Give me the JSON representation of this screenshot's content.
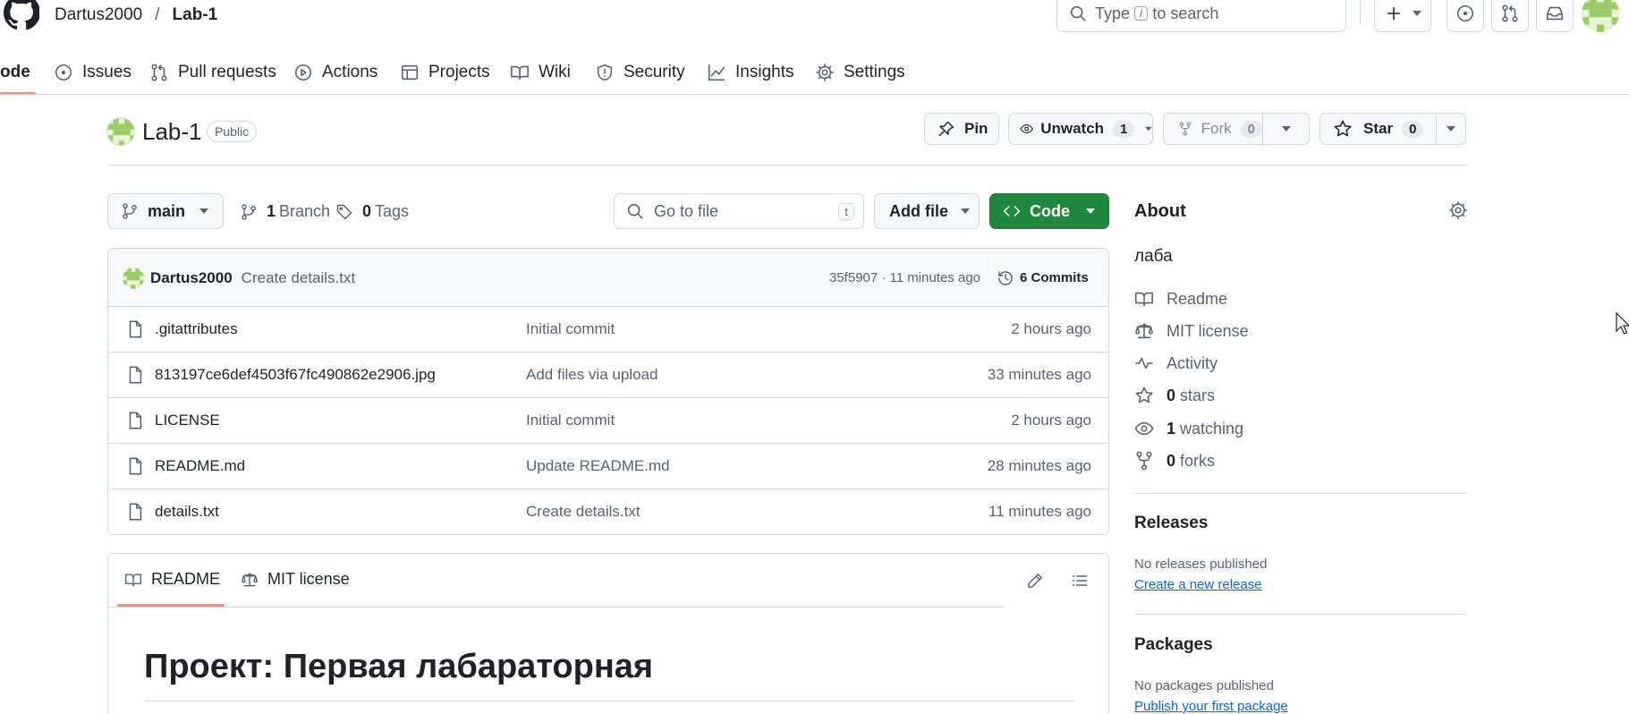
{
  "header": {
    "owner": "Dartus2000",
    "separator": "/",
    "repo": "Lab-1",
    "search_placeholder_type": "Type",
    "search_key": "/",
    "search_placeholder_rest": "to search"
  },
  "tabs": [
    {
      "label": "ode",
      "icon": "code-icon"
    },
    {
      "label": "Issues",
      "icon": "issue-icon"
    },
    {
      "label": "Pull requests",
      "icon": "pull-request-icon"
    },
    {
      "label": "Actions",
      "icon": "play-icon"
    },
    {
      "label": "Projects",
      "icon": "table-icon"
    },
    {
      "label": "Wiki",
      "icon": "book-icon"
    },
    {
      "label": "Security",
      "icon": "shield-icon"
    },
    {
      "label": "Insights",
      "icon": "graph-icon"
    },
    {
      "label": "Settings",
      "icon": "gear-icon"
    }
  ],
  "repo": {
    "name": "Lab-1",
    "visibility": "Public",
    "pin_label": "Pin",
    "unwatch_label": "Unwatch",
    "watch_count": "1",
    "fork_label": "Fork",
    "fork_count": "0",
    "star_label": "Star",
    "star_count": "0"
  },
  "toolbar": {
    "branch": "main",
    "branches_count": "1",
    "branches_label": "Branch",
    "tags_count": "0",
    "tags_label": "Tags",
    "goto_placeholder": "Go to file",
    "goto_key": "t",
    "add_file_label": "Add file",
    "code_label": "Code"
  },
  "commit": {
    "author": "Dartus2000",
    "message": "Create details.txt",
    "hash_time": "35f5907 · 11 minutes ago",
    "commits_label": "6 Commits"
  },
  "files": [
    {
      "name": ".gitattributes",
      "message": "Initial commit",
      "time": "2 hours ago"
    },
    {
      "name": "813197ce6def4503f67fc490862e2906.jpg",
      "message": "Add files via upload",
      "time": "33 minutes ago"
    },
    {
      "name": "LICENSE",
      "message": "Initial commit",
      "time": "2 hours ago"
    },
    {
      "name": "README.md",
      "message": "Update README.md",
      "time": "28 minutes ago"
    },
    {
      "name": "details.txt",
      "message": "Create details.txt",
      "time": "11 minutes ago"
    }
  ],
  "readme": {
    "tab_readme": "README",
    "tab_license": "MIT license",
    "heading": "Проект: Первая лабараторная"
  },
  "about": {
    "title": "About",
    "description": "лаба",
    "readme": "Readme",
    "license": "MIT license",
    "activity": "Activity",
    "stars_count": "0",
    "stars_label": "stars",
    "watching_count": "1",
    "watching_label": "watching",
    "forks_count": "0",
    "forks_label": "forks"
  },
  "releases": {
    "title": "Releases",
    "empty": "No releases published",
    "link": "Create a new release"
  },
  "packages": {
    "title": "Packages",
    "empty": "No packages published",
    "link": "Publish your first package"
  },
  "colors": {
    "accent_green": "#1f883d",
    "link_blue": "#0969da",
    "active_tab_underline": "#fd8c73"
  }
}
